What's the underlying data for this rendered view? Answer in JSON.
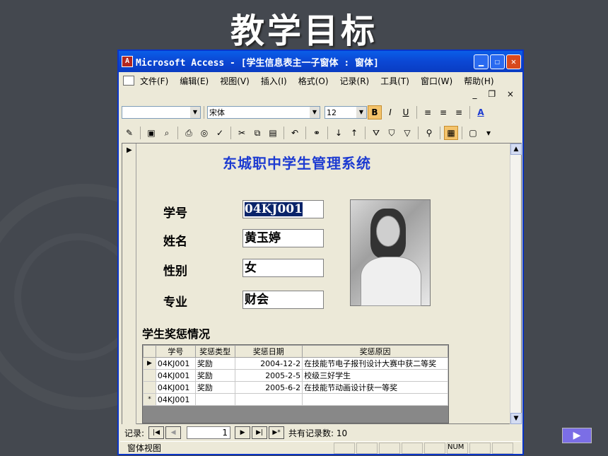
{
  "slide_title": "教学目标",
  "window": {
    "title": "Microsoft Access - [学生信息表主一子窗体 : 窗体]",
    "icon_text": "A"
  },
  "menu": [
    "文件(F)",
    "编辑(E)",
    "视图(V)",
    "插入(I)",
    "格式(O)",
    "记录(R)",
    "工具(T)",
    "窗口(W)",
    "帮助(H)"
  ],
  "mdi_controls": "_ ❐ ×",
  "toolbar": {
    "object_combo": "",
    "font": "宋体",
    "size": "12",
    "bold": "B",
    "italic": "I",
    "underline": "U"
  },
  "form": {
    "title": "东城职中学生管理系统",
    "labels": {
      "id": "学号",
      "name": "姓名",
      "gender": "性别",
      "major": "专业"
    },
    "values": {
      "id": "04KJ001",
      "name": "黄玉婷",
      "gender": "女",
      "major": "财会"
    },
    "subform_title": "学生奖惩情况",
    "table": {
      "headers": [
        "学号",
        "奖惩类型",
        "奖惩日期",
        "奖惩原因"
      ],
      "rows": [
        {
          "marker": "▶",
          "id": "04KJ001",
          "type": "奖励",
          "date": "2004-12-2",
          "reason": "在技能节电子报刊设计大赛中获二等奖"
        },
        {
          "marker": "",
          "id": "04KJ001",
          "type": "奖励",
          "date": "2005-2-5",
          "reason": "校级三好学生"
        },
        {
          "marker": "",
          "id": "04KJ001",
          "type": "奖励",
          "date": "2005-6-2",
          "reason": "在技能节动画设计获一等奖"
        },
        {
          "marker": "*",
          "id": "04KJ001",
          "type": "",
          "date": "",
          "reason": ""
        }
      ]
    }
  },
  "navigation": {
    "label": "记录:",
    "current": "1",
    "total": "共有记录数: 10"
  },
  "status": {
    "left": "窗体视图",
    "num": "NUM"
  },
  "next_arrow": "▶"
}
